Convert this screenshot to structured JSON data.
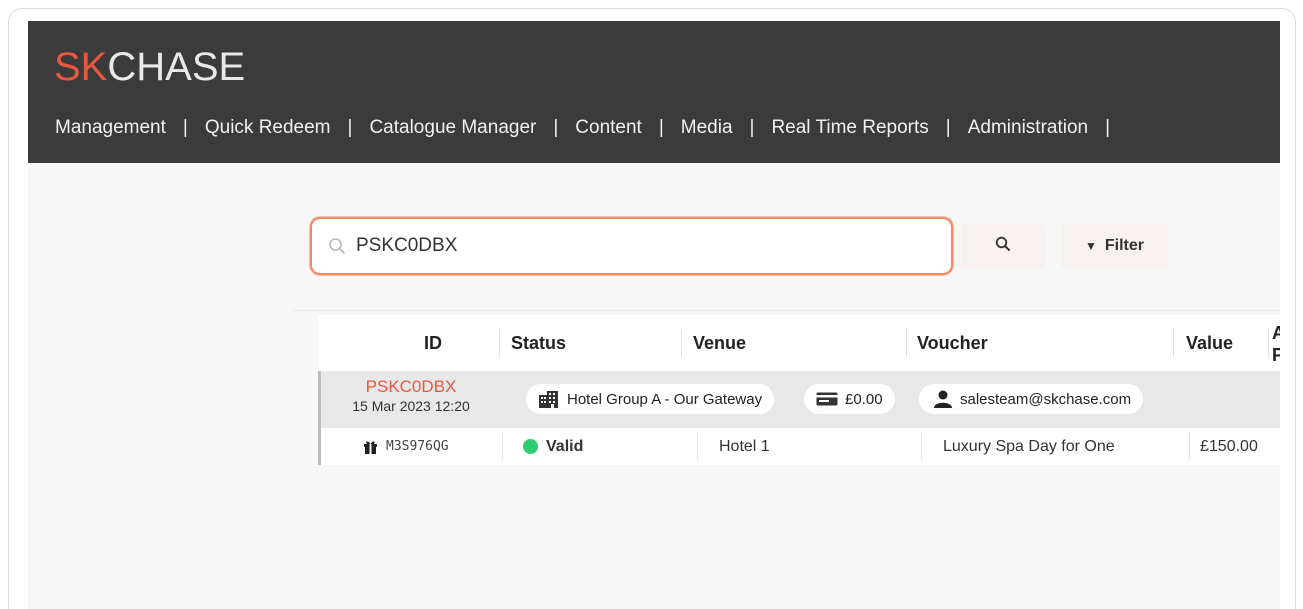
{
  "logo": {
    "part1": "SK",
    "part2": "CHASE"
  },
  "nav": {
    "items": [
      "Management",
      "Quick Redeem",
      "Catalogue Manager",
      "Content",
      "Media",
      "Real Time Reports",
      "Administration"
    ],
    "separator": "|"
  },
  "search": {
    "value": "PSKC0DBX",
    "placeholder": ""
  },
  "filter": {
    "label": "Filter"
  },
  "table": {
    "columns": [
      "ID",
      "Status",
      "Venue",
      "Voucher",
      "Value",
      "A",
      "P"
    ],
    "group": {
      "code": "PSKC0DBX",
      "date": "15 Mar 2023 12:20",
      "venue": "Hotel Group A - Our Gateway",
      "amount": "£0.00",
      "email": "salesteam@skchase.com"
    },
    "rows": [
      {
        "id": "M3S976QG",
        "status": "Valid",
        "venue": "Hotel 1",
        "voucher": "Luxury Spa Day for One",
        "value": "£150.00",
        "extra": "£"
      }
    ]
  },
  "colors": {
    "accent": "#e8573e",
    "header": "#3b3b3b",
    "valid": "#2ecc71",
    "search_border": "#f08a62"
  },
  "icons": {
    "search": "search-icon",
    "gift": "gift-icon",
    "building": "building-icon",
    "card": "card-icon",
    "user": "user-icon",
    "filter": "funnel-icon"
  }
}
